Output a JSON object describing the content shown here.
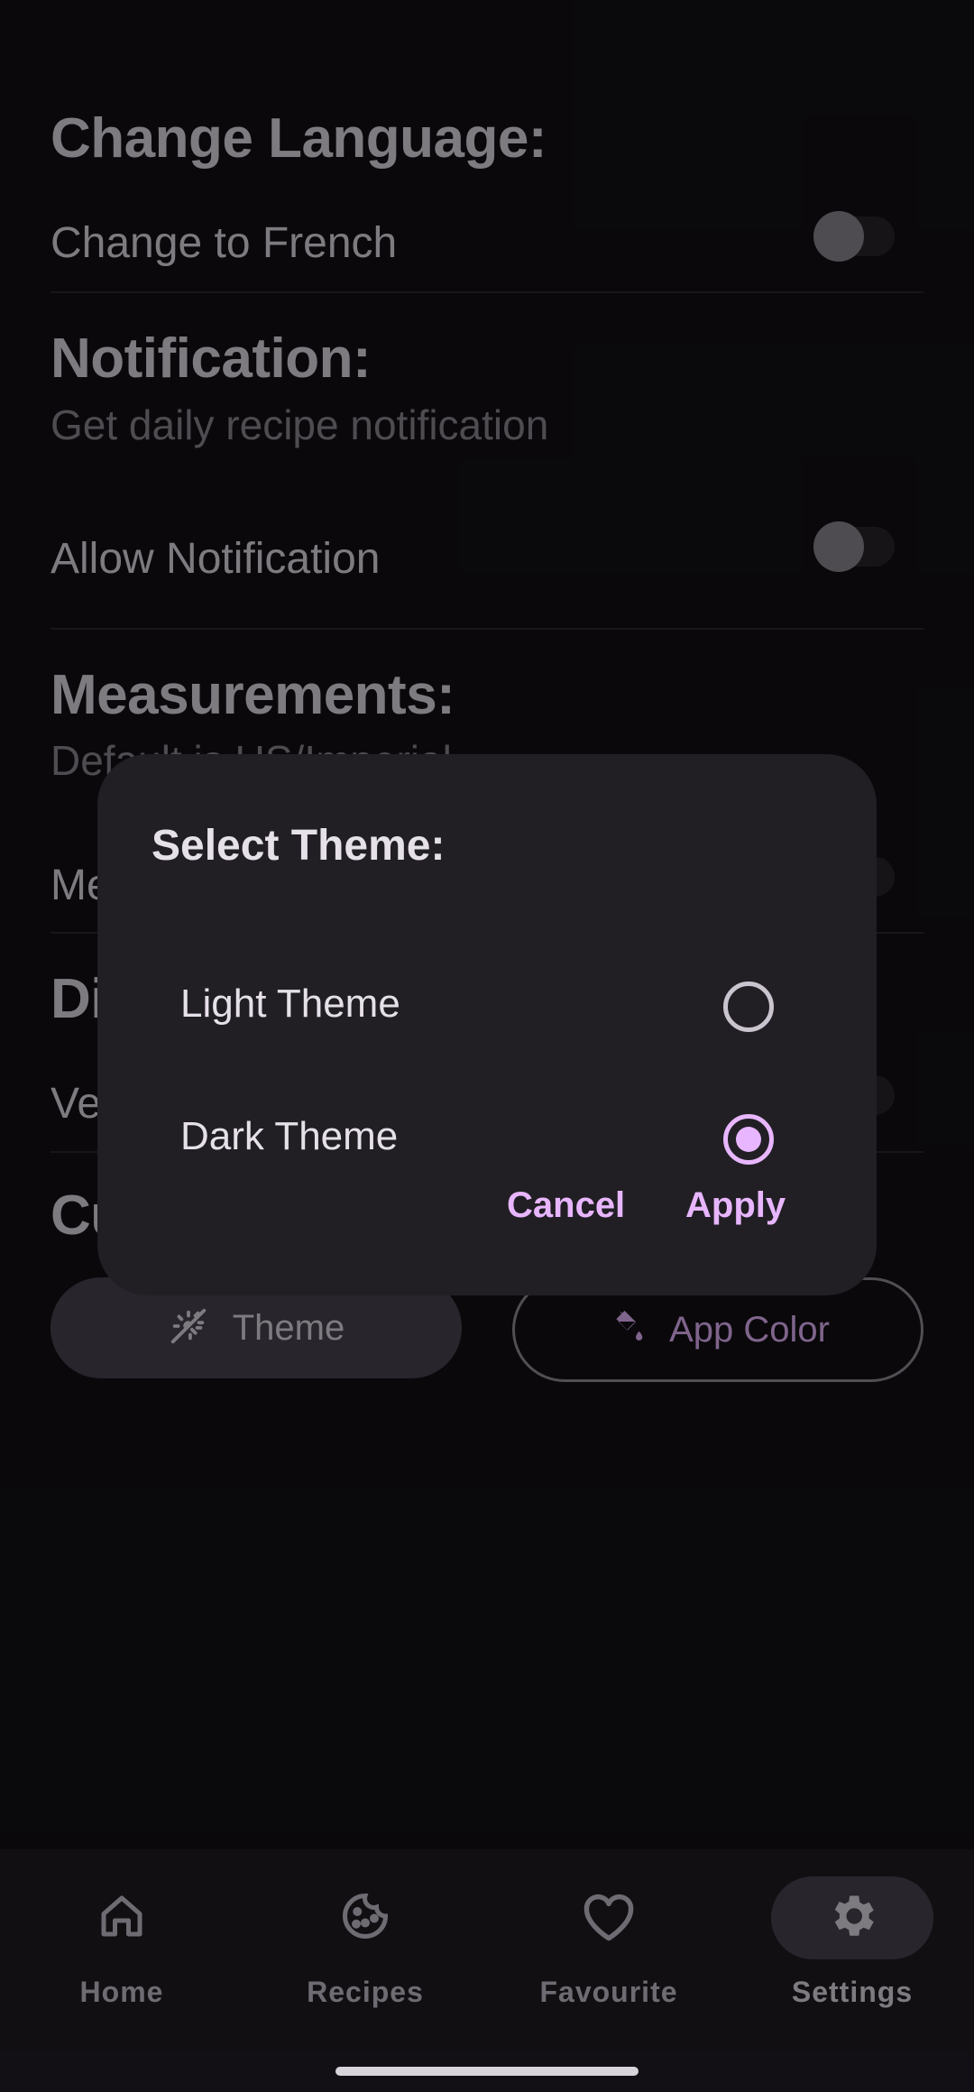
{
  "settings": {
    "language_heading": "Change Language:",
    "change_french": "Change to French",
    "notification_heading": "Notification:",
    "notification_sub": "Get daily recipe notification",
    "allow_notification": "Allow Notification",
    "measurements_heading": "Measurements:",
    "measurements_sub": "Default is US/Imperial",
    "measurements_row": "Me",
    "diet_heading": "Di",
    "diet_row": "Ve",
    "custom_heading": "Cu",
    "theme_button": "Theme",
    "app_color_button": "App Color",
    "toggles": {
      "french": false,
      "notification": false,
      "measurements": false,
      "vegetarian": false
    }
  },
  "dialog": {
    "title": "Select Theme:",
    "options": [
      {
        "label": "Light Theme",
        "selected": false
      },
      {
        "label": "Dark Theme",
        "selected": true
      }
    ],
    "cancel": "Cancel",
    "apply": "Apply"
  },
  "bottom_nav": {
    "items": [
      {
        "label": "Home",
        "icon": "home-icon",
        "active": false
      },
      {
        "label": "Recipes",
        "icon": "cookie-icon",
        "active": false
      },
      {
        "label": "Favourite",
        "icon": "heart-icon",
        "active": false
      },
      {
        "label": "Settings",
        "icon": "gear-icon",
        "active": true
      }
    ]
  },
  "colors": {
    "background": "#131015",
    "accent": "#e8b6ff",
    "dialog": "#211f24",
    "nav": "#211d24"
  }
}
